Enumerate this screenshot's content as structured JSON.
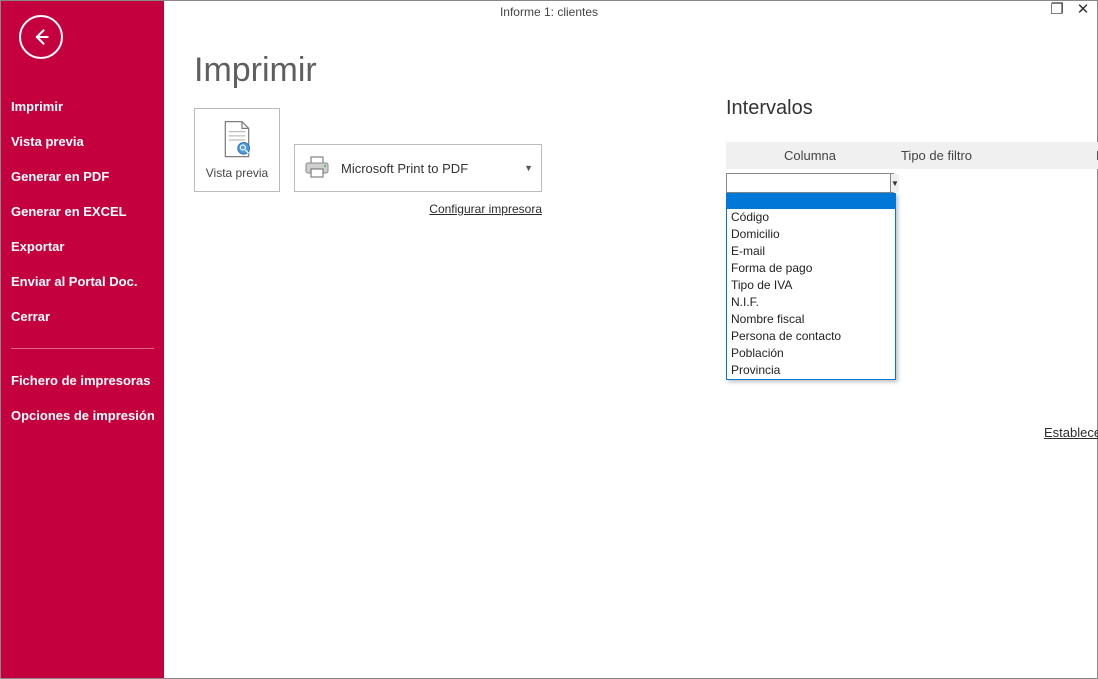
{
  "window": {
    "title": "Informe 1: clientes"
  },
  "sidebar": {
    "items": [
      "Imprimir",
      "Vista previa",
      "Generar en PDF",
      "Generar en EXCEL",
      "Exportar",
      "Enviar al Portal Doc.",
      "Cerrar"
    ],
    "items2": [
      "Fichero de impresoras",
      "Opciones de impresión"
    ]
  },
  "print": {
    "title": "Imprimir",
    "preview_label": "Vista previa",
    "printer_name": "Microsoft Print to PDF",
    "configure_link": "Configurar impresora"
  },
  "intervals": {
    "title": "Intervalos",
    "headers": {
      "col": "Columna",
      "tipo": "Tipo de filtro",
      "filtro": "Filtro"
    },
    "combo_value": "",
    "options": [
      "Código",
      "Domicilio",
      "E-mail",
      "Forma de pago",
      "Tipo de IVA",
      "N.I.F.",
      "Nombre fiscal",
      "Persona de contacto",
      "Población",
      "Provincia"
    ],
    "set_default": "Establecer como predeterminados"
  }
}
